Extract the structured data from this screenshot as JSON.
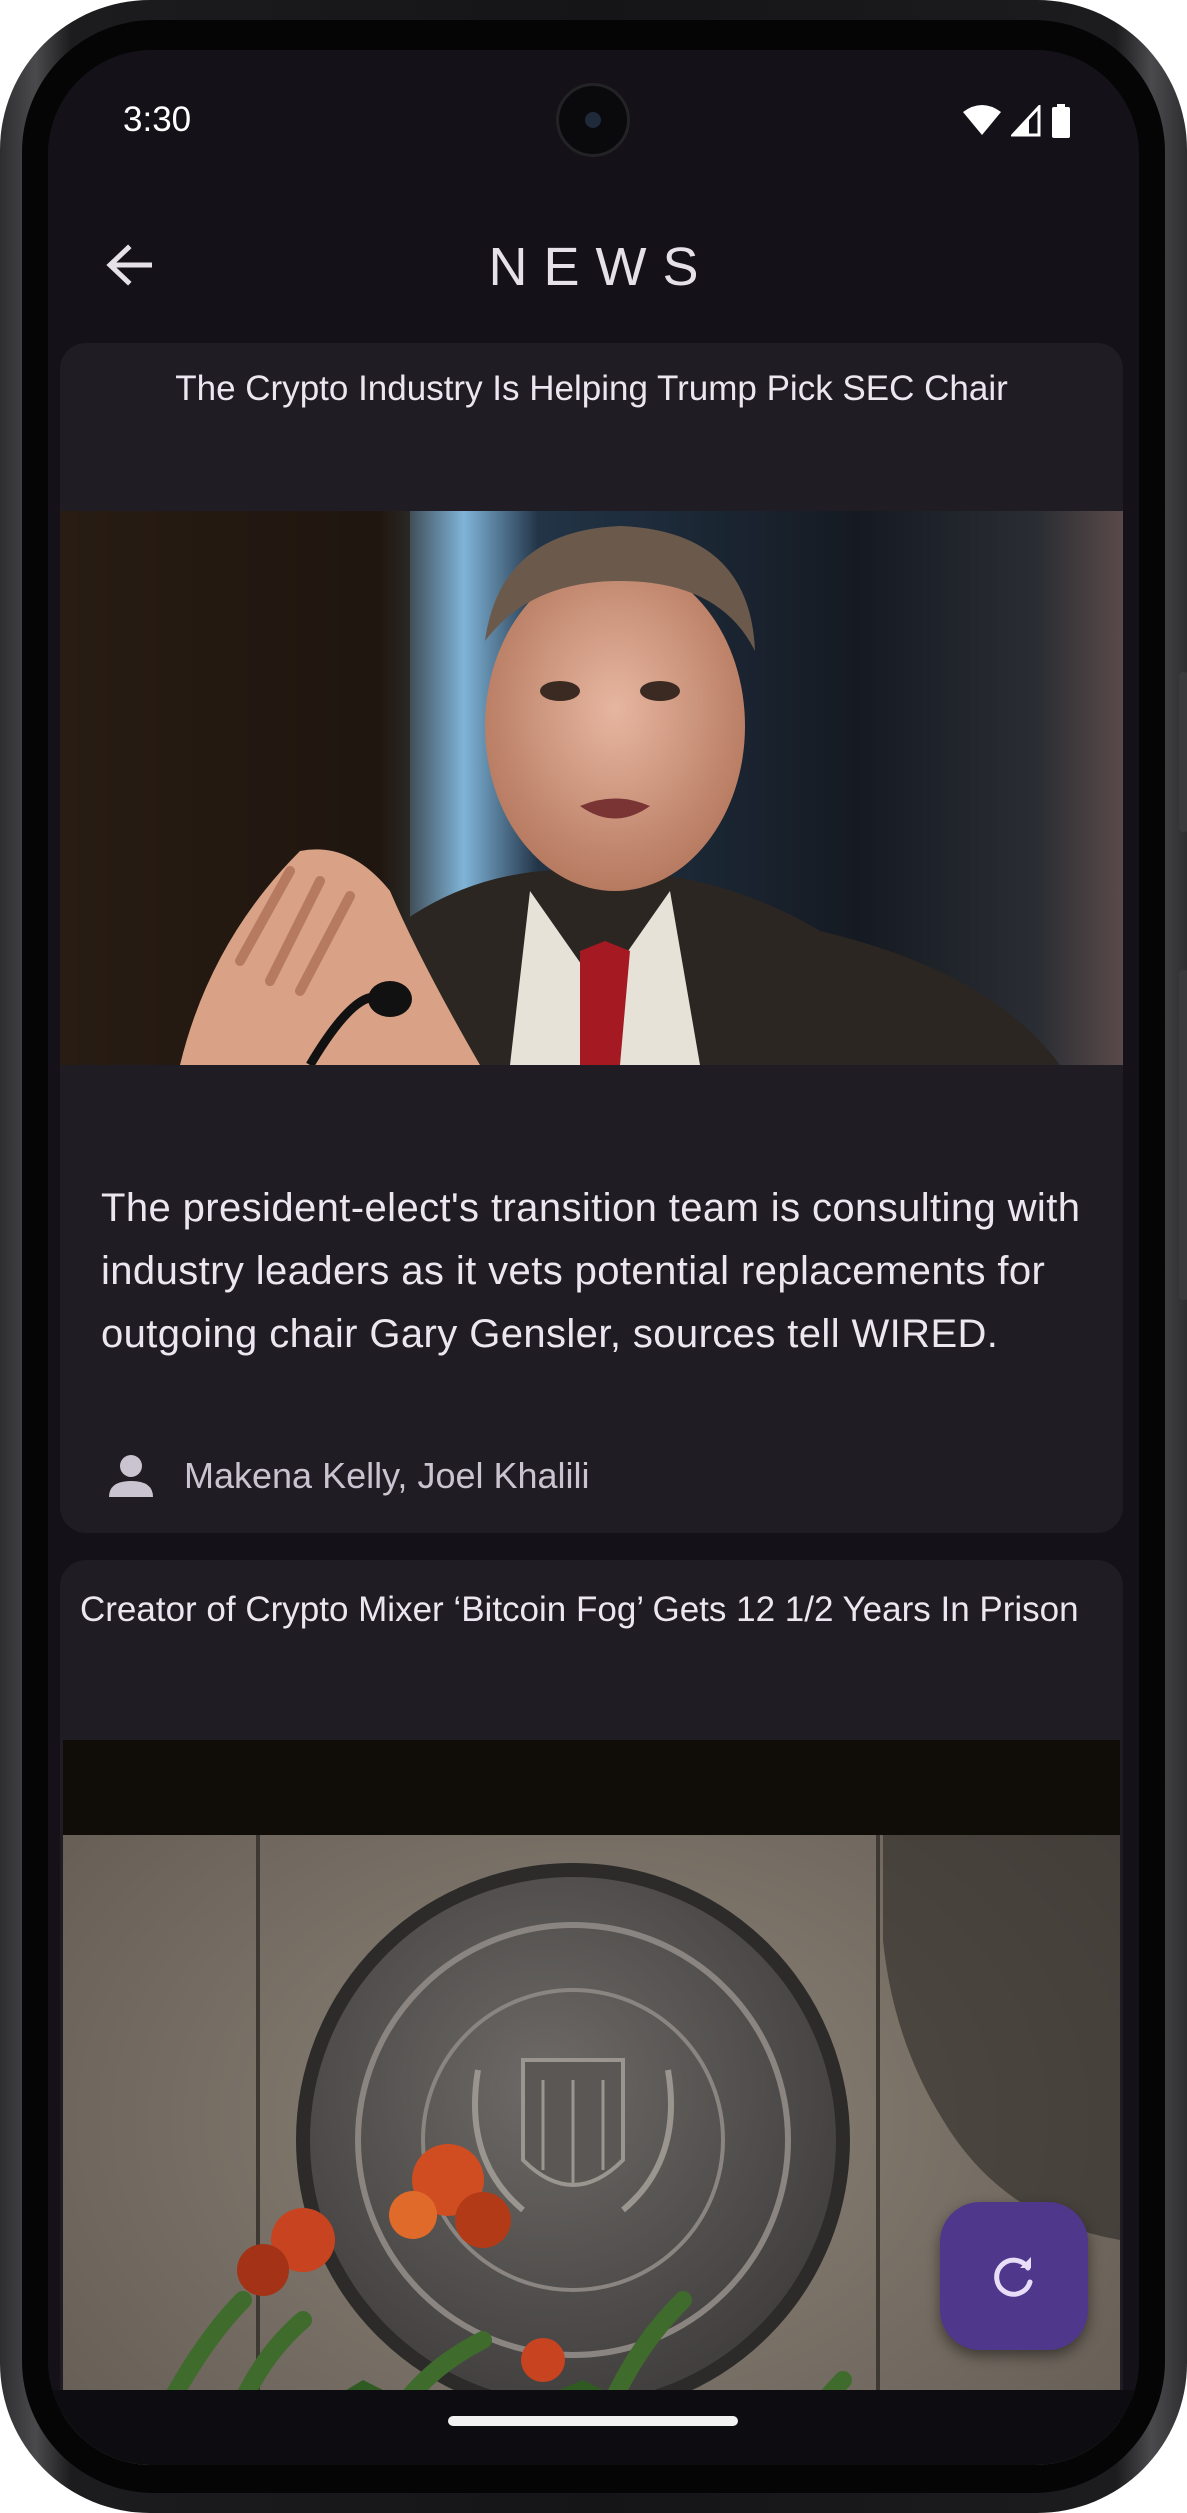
{
  "status_bar": {
    "time": "3:30",
    "icons": [
      "wifi-icon",
      "cell-signal-icon",
      "battery-icon"
    ]
  },
  "app_bar": {
    "title": "NEWS",
    "back_icon": "arrow-back-icon"
  },
  "articles": [
    {
      "headline": "The Crypto Industry Is Helping Trump Pick SEC Chair",
      "image": "photo of man in suit speaking at microphone",
      "summary": "The president-elect's transition team is consulting with industry leaders as it vets potential replacements for outgoing chair Gary Gensler, sources tell WIRED.",
      "author_icon": "person-icon",
      "author": "Makena Kelly, Joel Khalili"
    },
    {
      "headline": "Creator of Crypto Mixer ‘Bitcoin Fog’ Gets 12 1/2 Years In Prison",
      "image": "Department of Justice FBI seal with flowers in foreground"
    }
  ],
  "fab": {
    "icon": "refresh-icon"
  },
  "colors": {
    "background": "#141218",
    "card": "#1f1d23",
    "fab": "#4f378b",
    "text": "#ece6f0"
  }
}
